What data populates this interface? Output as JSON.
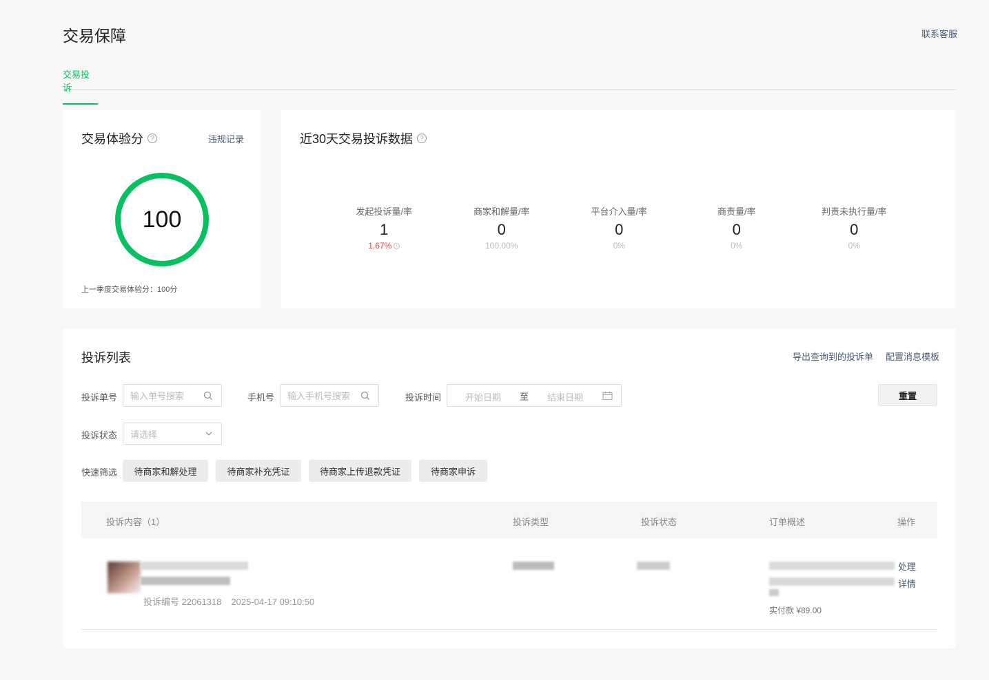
{
  "header": {
    "title": "交易保障",
    "contact": "联系客服"
  },
  "tabs": [
    {
      "label": "交易投诉",
      "active": true
    }
  ],
  "score_card": {
    "title": "交易体验分",
    "violation_link": "违规记录",
    "score": "100",
    "score_progress": 1.0,
    "last_season": "上一季度交易体验分：100分"
  },
  "stats_card": {
    "title": "近30天交易投诉数据",
    "items": [
      {
        "label": "发起投诉量/率",
        "value": "1",
        "rate": "1.67%"
      },
      {
        "label": "商家和解量/率",
        "value": "0",
        "rate": "100.00%"
      },
      {
        "label": "平台介入量/率",
        "value": "0",
        "rate": "0%"
      },
      {
        "label": "商责量/率",
        "value": "0",
        "rate": "0%"
      },
      {
        "label": "判责未执行量/率",
        "value": "0",
        "rate": "0%"
      }
    ]
  },
  "list_card": {
    "title": "投诉列表",
    "export_link": "导出查询到的投诉单",
    "template_link": "配置消息模板",
    "filters": {
      "order_no_label": "投诉单号",
      "order_no_placeholder": "输入单号搜索",
      "phone_label": "手机号",
      "phone_placeholder": "输入手机号搜索",
      "time_label": "投诉时间",
      "start_placeholder": "开始日期",
      "range_sep": "至",
      "end_placeholder": "结束日期",
      "reset": "重置",
      "status_label": "投诉状态",
      "status_placeholder": "请选择",
      "quick_label": "快速筛选",
      "quick": [
        "待商家和解处理",
        "待商家补充凭证",
        "待商家上传退款凭证",
        "待商家申诉"
      ]
    },
    "table": {
      "columns": [
        "投诉内容（1）",
        "投诉类型",
        "投诉状态",
        "订单概述",
        "操作"
      ],
      "rows": [
        {
          "complaint_no": "投诉编号 22061318",
          "time": "2025-04-17 09:10:50",
          "paid": "实付款 ¥89.00",
          "actions": [
            "处理",
            "详情"
          ]
        }
      ]
    }
  },
  "colors": {
    "accent": "#07c160",
    "link": "#4a5a72",
    "alert": "#e64340"
  }
}
